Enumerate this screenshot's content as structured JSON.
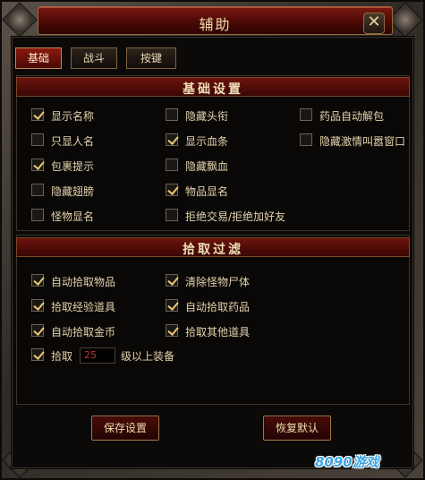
{
  "window": {
    "title": "辅助",
    "close_symbol": "✕"
  },
  "tabs": [
    {
      "label": "基础",
      "active": true
    },
    {
      "label": "战斗",
      "active": false
    },
    {
      "label": "按键",
      "active": false
    }
  ],
  "basic_settings": {
    "header": "基础设置",
    "options": [
      {
        "label": "显示名称",
        "checked": true
      },
      {
        "label": "只显人名",
        "checked": false
      },
      {
        "label": "包裹提示",
        "checked": true
      },
      {
        "label": "隐藏翅膀",
        "checked": false
      },
      {
        "label": "怪物显名",
        "checked": false
      },
      {
        "label": "隐藏头衔",
        "checked": false
      },
      {
        "label": "显示血条",
        "checked": true
      },
      {
        "label": "隐藏飘血",
        "checked": false
      },
      {
        "label": "物品显名",
        "checked": true
      },
      {
        "label": "拒绝交易/拒绝加好友",
        "checked": false
      },
      {
        "label": "药品自动解包",
        "checked": false
      },
      {
        "label": "隐藏激情叫嚣窗口",
        "checked": false
      }
    ]
  },
  "pickup_filter": {
    "header": "拾取过滤",
    "options": [
      {
        "label": "自动拾取物品",
        "checked": true
      },
      {
        "label": "拾取经验道具",
        "checked": true
      },
      {
        "label": "自动拾取金币",
        "checked": true
      },
      {
        "label": "清除怪物尸体",
        "checked": true
      },
      {
        "label": "自动拾取药品",
        "checked": true
      },
      {
        "label": "拾取其他道具",
        "checked": true
      }
    ],
    "level_row": {
      "prefix": "拾取",
      "value": "25",
      "suffix": "级以上装备",
      "checked": true
    }
  },
  "buttons": {
    "save": "保存设置",
    "restore": "恢复默认"
  },
  "watermark": {
    "text": "8090游戏"
  },
  "colors": {
    "accent_red": "#6c130c",
    "text_gold": "#e3d2ad",
    "check_gold": "#e8c86a"
  }
}
